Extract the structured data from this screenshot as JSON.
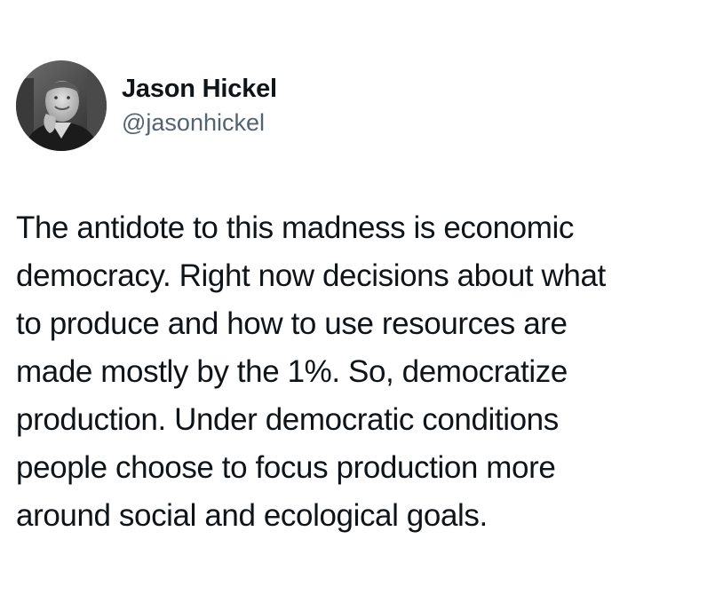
{
  "author": {
    "display_name": "Jason Hickel",
    "handle": "@jasonhickel",
    "avatar_icon": "profile-photo-icon"
  },
  "tweet": {
    "lines": [
      "The antidote to this madness is economic",
      "democracy. Right now decisions about what",
      "to produce and how to use resources are",
      "made mostly by the 1%. So, democratize",
      "production. Under democratic conditions",
      "people choose to focus production more",
      "around social and ecological goals."
    ]
  },
  "colors": {
    "text": "#0f1419",
    "secondary_text": "#536471",
    "background": "#ffffff"
  }
}
